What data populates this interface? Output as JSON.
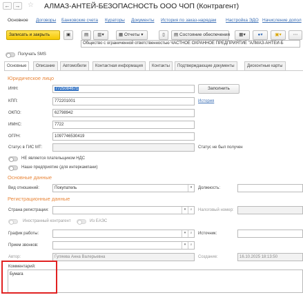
{
  "window": {
    "title": "АЛМАЗ-АНТЕЙ-БЕЗОПАСНОСТЬ ООО ЧОП (Контрагент)"
  },
  "nav": {
    "main": "Основное",
    "links": [
      "Договоры",
      "Банковские счета",
      "Кураторы",
      "Документы",
      "История по заказ-нарядам",
      "Настройка ЭДО",
      "Начисление допол"
    ]
  },
  "toolbar": {
    "save_close": "Записать и закрыть",
    "reports": "Отчеты",
    "state": "Состояние обеспечения"
  },
  "full_name_value": "Общество с ограниченной ответственностью ЧАСТНОЕ ОХРАННОЕ ПРЕДПРИЯТИЕ \"АЛМАЗ-АНТЕЙ-Б",
  "sms_label": "Получать SMS",
  "tabs": [
    "Основные",
    "Описание",
    "Автомобили",
    "Контактная информация",
    "Контакты",
    "Подтверждающие документы",
    "Дисконтные карты"
  ],
  "legal": {
    "section": "Юридическое лицо",
    "inn_label": "ИНН:",
    "inn_value": "7725084671",
    "fill_button": "Заполнить",
    "kpp_label": "КПП:",
    "kpp_value": "772201001",
    "history_link": "История",
    "okpo_label": "ОКПО:",
    "okpo_value": "62798942",
    "imns_label": "ИМНС:",
    "imns_value": "7722",
    "ogrn_label": "ОГРН:",
    "ogrn_value": "1097746530419",
    "gis_label": "Статус в ГИС МТ:",
    "gis_status": "Статус не был получен",
    "not_vat_label": "НЕ является плательщиком НДС",
    "intercompany_label": "Наше предприятие (для интеркампани)"
  },
  "basic": {
    "section": "Основные данные",
    "relation_label": "Вид отношений:",
    "relation_value": "Покупатель",
    "position_label": "Должность:"
  },
  "registration": {
    "section": "Регистрационные данные",
    "country_label": "Страна регистрации:",
    "tax_number_label": "Налоговый номер:",
    "foreign_label": "Иностранный контрагент",
    "eaes_label": "Из ЕАЭС",
    "schedule_label": "График работы:",
    "source_label": "Источник:",
    "calls_label": "Прием звонков:",
    "author_label": "Автор:",
    "author_value": "Гуляева Анна Валерьевна",
    "created_label": "Создание:",
    "created_value": "16.10.2025 18:13:50"
  },
  "comment": {
    "label": "Комментарий:",
    "value": "Бумага"
  }
}
